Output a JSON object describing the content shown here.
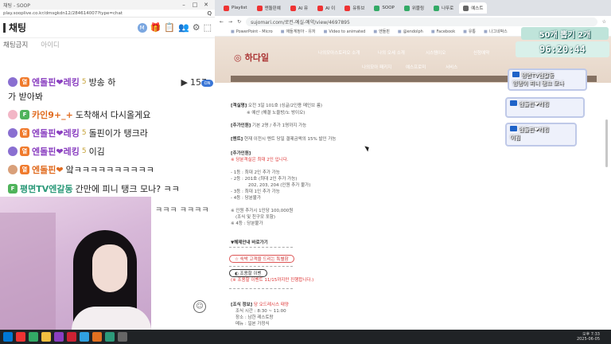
{
  "chat_window": {
    "title": "채팅 - SOOP",
    "url": "play.sooplive.co.kr/dmsgkdn12/284614007?type=chat",
    "zoom_label": "Q",
    "header": {
      "title": "채팅",
      "m_badge": "M"
    },
    "filter_active": "채팅금지",
    "filter_inactive": "아이디",
    "viewer_count": "157",
    "live_label": "ON",
    "messages": [
      {
        "nick": "엔돌핀❤레킹",
        "level": "5",
        "text": "방송 하",
        "extra": "일"
      },
      {
        "nick": "",
        "level": "",
        "text": "가 받아봐",
        "extra": ""
      },
      {
        "nick": "카인9+_+",
        "level": "",
        "text": "도착해서 다시올게요",
        "extra": ""
      },
      {
        "nick": "엔돌핀❤레킹",
        "level": "5",
        "text": "돌핀이가 탱크라",
        "extra": ""
      },
      {
        "nick": "엔돌핀❤레킹",
        "level": "5",
        "text": "이김",
        "extra": ""
      },
      {
        "nick": "엔돌핀❤",
        "level": "",
        "text": "앜ㅋㅋㅋㅋㅋㅋㅋㅋㅋㅋ",
        "extra": ""
      },
      {
        "nick": "평면TV엔갈동",
        "level": "",
        "text": "간만에 피니 탱크 모나? ㅋㅋ",
        "extra": ""
      }
    ],
    "overflow_text": "ㅋㅋㅋ ㅋㅋㅋㅋ",
    "badge_letters": {
      "orange": "열",
      "green": "F"
    }
  },
  "browser": {
    "tabs": [
      {
        "label": "Playlist",
        "color": "#e33"
      },
      {
        "label": "엔돌핀예",
        "color": "#e33"
      },
      {
        "label": "AI 뮤",
        "color": "#e33"
      },
      {
        "label": "AI 이",
        "color": "#e33"
      },
      {
        "label": "유튜브",
        "color": "#e33"
      },
      {
        "label": "SOOP",
        "color": "#3a6"
      },
      {
        "label": "위블링",
        "color": "#3a6"
      },
      {
        "label": "나뚜로",
        "color": "#3a6"
      },
      {
        "label": "예스트",
        "color": "#666"
      }
    ],
    "url": "sujomari.com/로컨-예실-예약/view/4697895",
    "bookmarks": [
      "PowerPoint - Micro",
      "애들계정아 - 유저",
      "Video to animated",
      "엔돌핀",
      "@endolph",
      "Facebook",
      "유통",
      "나그네박스"
    ],
    "site_logo": "하다일",
    "nav_items": [
      "나의모아스토리오 소개",
      "나의 오세 소개",
      "시스템이오",
      "신청예약"
    ],
    "nav_items_2": [
      "나의모아 패키지",
      "예스프로미",
      "서비스"
    ],
    "doc": {
      "room_label": "[객실명]",
      "room_text": "오전 3일 101호 (싱글/2인용 메인브 룸)",
      "room_sub": "※ 예산 (해결 노을방/노 방이오)",
      "extra_label": "[추가인원]",
      "extra_text": "기본 2명 / 추가 1명까지 가능",
      "mention_label": "[멘트]",
      "mention_text": "현재 이전시 멘트 당일 결제금액의 15% 발인 가능",
      "add_label": "[추가인원]",
      "add_note": "※ 당분객실은 최대 2인 입니다.",
      "lines": [
        "- 1등 : 최대 2인 추가 가능",
        "- 2등 : 201호 (최대 2인 추가 가능)",
        "202, 203, 204 (인원 추가 불가)",
        "- 3등 : 최대 1인 추가 가능",
        "- 4등 : 당분불가"
      ],
      "price_note": "※ 인원 추가시 1인당 100,000원",
      "price_sub1": "(조식 및 친구모 포함)",
      "price_sub2": "※ 4등 : 당분불가",
      "section": "▼해제안내 바로가기",
      "pill1": "☆ 숙박 고객을 드리는 특별함",
      "pill2": "◐ 조용할 이벤",
      "event_note": "(※ 조용할 이벤트 11/15까지만 진행합니다.)",
      "guide_label": "[조식 정보]",
      "guide_title": "당 오드레시스 태양",
      "guide_lines": [
        "조식 시간 : 8:30 ~ 11:00",
        "장소 : 남한 레스토랑",
        "메뉴 : 일본 가정식"
      ]
    }
  },
  "overlays": {
    "goal": "50개 뽑기 2개",
    "timer": "96:20:44",
    "cards": [
      {
        "text": "평면TV엔갈동",
        "sub": "잉맹이 피니 탱크 모나"
      },
      {
        "text": "엔돌핀❤레킹",
        "sub": ""
      },
      {
        "text": "엔돌핀❤레킹",
        "sub": "이김"
      }
    ]
  },
  "taskbar": {
    "time": "오후 7:33",
    "date": "2025-06-05",
    "icons": [
      "#0078d4",
      "#e33",
      "#3a6",
      "#f0c040",
      "#8a3fc0",
      "#c23",
      "#30a0e0",
      "#e07020",
      "#2d9a7a",
      "#666"
    ]
  }
}
